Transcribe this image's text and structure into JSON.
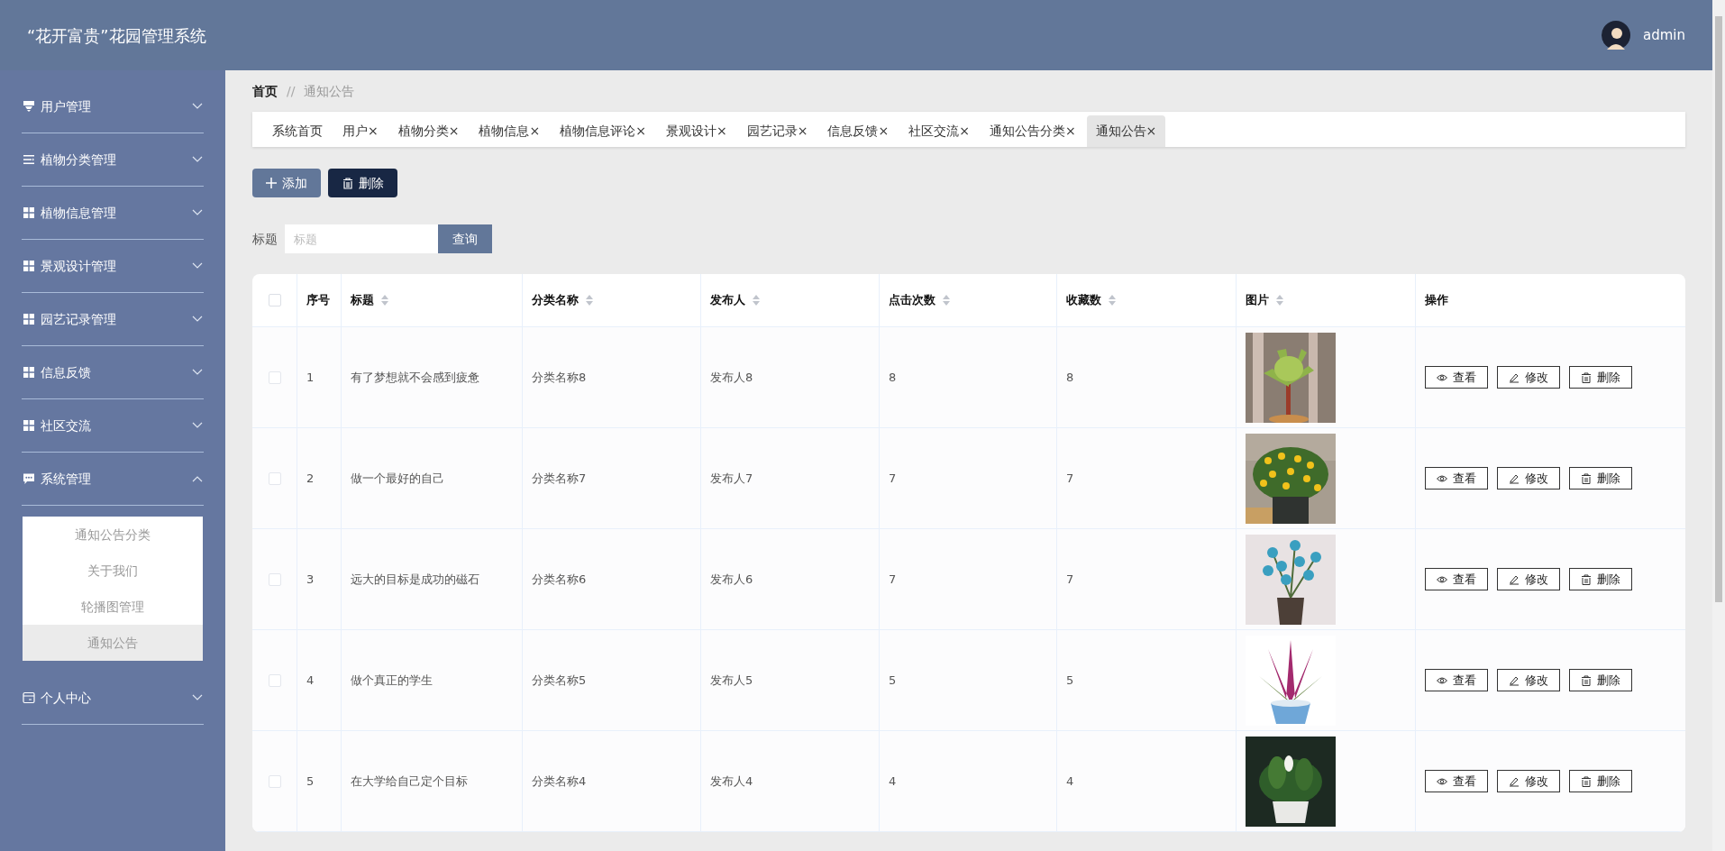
{
  "header": {
    "title": "“花开富贵”花园管理系统",
    "user": "admin"
  },
  "sidebar": {
    "items": [
      {
        "label": "用户管理",
        "expanded": false
      },
      {
        "label": "植物分类管理",
        "expanded": false
      },
      {
        "label": "植物信息管理",
        "expanded": false
      },
      {
        "label": "景观设计管理",
        "expanded": false
      },
      {
        "label": "园艺记录管理",
        "expanded": false
      },
      {
        "label": "信息反馈",
        "expanded": false
      },
      {
        "label": "社区交流",
        "expanded": false
      },
      {
        "label": "系统管理",
        "expanded": true,
        "children": [
          {
            "label": "通知公告分类",
            "selected": false
          },
          {
            "label": "关于我们",
            "selected": false
          },
          {
            "label": "轮播图管理",
            "selected": false
          },
          {
            "label": "通知公告",
            "selected": true
          }
        ]
      },
      {
        "label": "个人中心",
        "expanded": false
      }
    ]
  },
  "breadcrumb": {
    "home": "首页",
    "separator": "//",
    "current": "通知公告"
  },
  "tabs": [
    {
      "label": "系统首页",
      "selected": false
    },
    {
      "label": "用户",
      "close": "×",
      "selected": false
    },
    {
      "label": "植物分类",
      "close": "×",
      "selected": false
    },
    {
      "label": "植物信息",
      "close": "×",
      "selected": false
    },
    {
      "label": "植物信息评论",
      "close": "×",
      "selected": false
    },
    {
      "label": "景观设计",
      "close": "×",
      "selected": false
    },
    {
      "label": "园艺记录",
      "close": "×",
      "selected": false
    },
    {
      "label": "信息反馈",
      "close": "×",
      "selected": false
    },
    {
      "label": "社区交流",
      "close": "×",
      "selected": false
    },
    {
      "label": "通知公告分类",
      "close": "×",
      "selected": false
    },
    {
      "label": "通知公告",
      "close": "×",
      "selected": true
    }
  ],
  "toolbar": {
    "add": "添加",
    "delete": "删除"
  },
  "search": {
    "label": "标题",
    "placeholder": "标题",
    "button": "查询"
  },
  "table": {
    "select_all_checked": false,
    "columns": [
      {
        "label": "序号",
        "sortable": false
      },
      {
        "label": "标题",
        "sortable": true
      },
      {
        "label": "分类名称",
        "sortable": true
      },
      {
        "label": "发布人",
        "sortable": true
      },
      {
        "label": "点击次数",
        "sortable": true
      },
      {
        "label": "收藏数",
        "sortable": true
      },
      {
        "label": "图片",
        "sortable": true
      },
      {
        "label": "操作",
        "sortable": false
      }
    ],
    "rows": [
      {
        "checked": false,
        "index": "1",
        "title": "有了梦想就不会感到疲惫",
        "category": "分类名称8",
        "publisher": "发布人8",
        "clicks": "8",
        "favorites": "8",
        "image": {
          "kind": "picture"
        },
        "actions": [
          "查看",
          "修改",
          "删除"
        ]
      },
      {
        "checked": false,
        "index": "2",
        "title": "做一个最好的自己",
        "category": "分类名称7",
        "publisher": "发布人7",
        "clicks": "7",
        "favorites": "7",
        "image": {
          "kind": "picture"
        },
        "actions": [
          "查看",
          "修改",
          "删除"
        ]
      },
      {
        "checked": false,
        "index": "3",
        "title": "远大的目标是成功的磁石",
        "category": "分类名称6",
        "publisher": "发布人6",
        "clicks": "7",
        "favorites": "7",
        "image": {
          "kind": "picture"
        },
        "actions": [
          "查看",
          "修改",
          "删除"
        ]
      },
      {
        "checked": false,
        "index": "4",
        "title": "做个真正的学生",
        "category": "分类名称5",
        "publisher": "发布人5",
        "clicks": "5",
        "favorites": "5",
        "image": {
          "kind": "picture"
        },
        "actions": [
          "查看",
          "修改",
          "删除"
        ]
      },
      {
        "checked": false,
        "index": "5",
        "title": "在大学给自己定个目标",
        "category": "分类名称4",
        "publisher": "发布人4",
        "clicks": "4",
        "favorites": "4",
        "image": {
          "kind": "picture"
        },
        "actions": [
          "查看",
          "修改",
          "删除"
        ]
      }
    ]
  }
}
